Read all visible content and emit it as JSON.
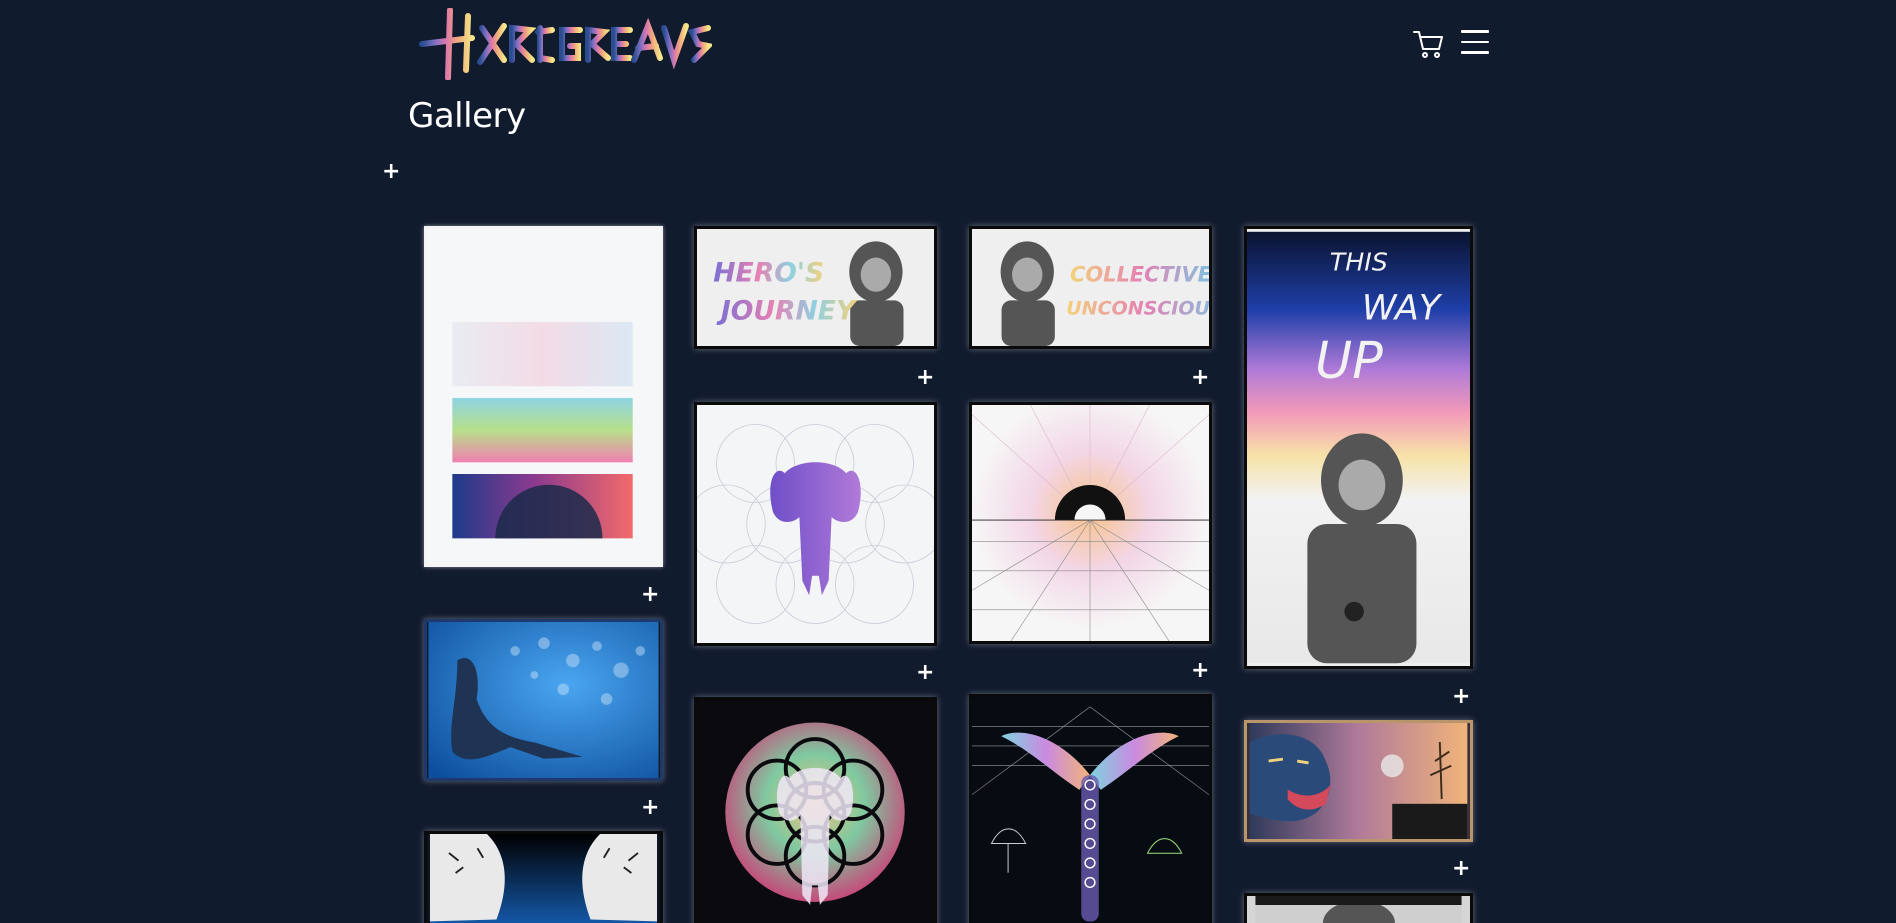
{
  "brand": {
    "logo_text": "HARGREAVES"
  },
  "header": {
    "cart_icon": "cart-icon",
    "menu_icon": "hamburger-menu-icon"
  },
  "page": {
    "title": "Gallery",
    "expand_glyph": "+"
  },
  "artworks": [
    {
      "name": "triptych-spectrum",
      "text": ""
    },
    {
      "name": "heros-journey",
      "text": "HERO'S JOURNEY"
    },
    {
      "name": "collective-unconscious",
      "text": "COLLECTIVE UNCONSCIOUS"
    },
    {
      "name": "this-way-up",
      "text": "THIS WAY UP"
    },
    {
      "name": "elephant-flower-of-life-white",
      "text": ""
    },
    {
      "name": "sunrise-grid",
      "text": ""
    },
    {
      "name": "floating-figure-blue",
      "text": ""
    },
    {
      "name": "elephant-flower-of-life-black",
      "text": ""
    },
    {
      "name": "chakra-figure",
      "text": ""
    },
    {
      "name": "panther-landscape",
      "text": ""
    },
    {
      "name": "white-tigers",
      "text": ""
    },
    {
      "name": "monochrome-partial",
      "text": ""
    }
  ],
  "colors": {
    "background": "#111b2e",
    "text": "#ffffff"
  }
}
